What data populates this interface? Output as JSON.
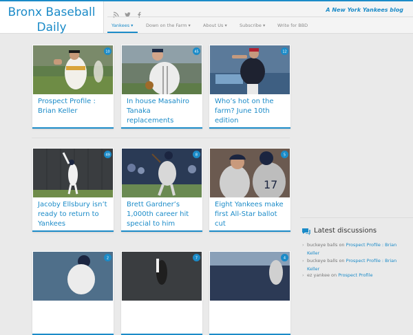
{
  "site": {
    "title": "Bronx Baseball Daily",
    "tagline": "A New York Yankees blog",
    "accent": "#1b8bc8"
  },
  "social": [
    "rss-icon",
    "twitter-icon",
    "facebook-icon"
  ],
  "nav": {
    "items": [
      {
        "label": "Yankees ▾",
        "active": true
      },
      {
        "label": "Down on the Farm ▾",
        "active": false
      },
      {
        "label": "About Us ▾",
        "active": false
      },
      {
        "label": "Subscribe ▾",
        "active": false
      },
      {
        "label": "Write for BBD",
        "active": false
      }
    ]
  },
  "cards": [
    {
      "title": "Prospect Profile : Brian Keller",
      "comments": "10"
    },
    {
      "title": "In house Masahiro Tanaka replacements",
      "comments": "45"
    },
    {
      "title": "Who’s hot on the farm? June 10th edition",
      "comments": "12"
    },
    {
      "title": "Jacoby Ellsbury isn’t ready to return to Yankees",
      "comments": "49"
    },
    {
      "title": "Brett Gardner’s 1,000th career hit special to him",
      "comments": "8"
    },
    {
      "title": "Eight Yankees make first All-Star ballot cut",
      "comments": "5"
    },
    {
      "title": "",
      "comments": "2"
    },
    {
      "title": "",
      "comments": "7"
    },
    {
      "title": "",
      "comments": "4"
    }
  ],
  "sidebar": {
    "widget_title": "Latest discussions",
    "discussions": [
      {
        "user": "buckeye balls",
        "on": "on",
        "post": "Prospect Profile : Brian Keller"
      },
      {
        "user": "buckeye balls",
        "on": "on",
        "post": "Prospect Profile : Brian Keller"
      },
      {
        "user": "ez yankee",
        "on": "on",
        "post": "Prospect Profile"
      }
    ]
  }
}
